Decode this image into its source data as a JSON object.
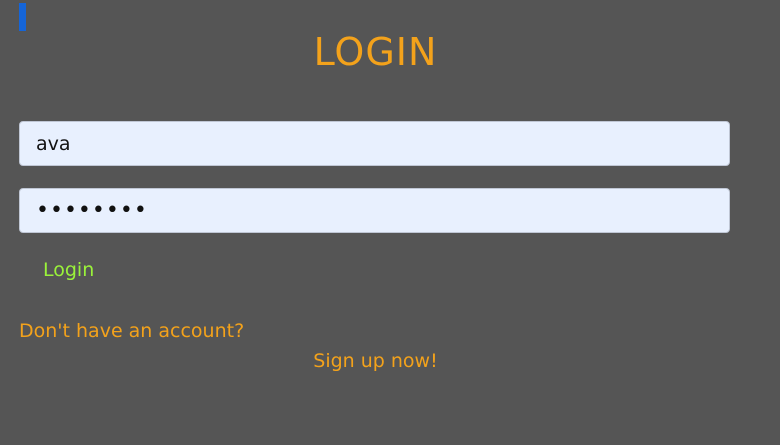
{
  "page": {
    "title": "LOGIN"
  },
  "form": {
    "username_value": "ava",
    "password_value": "ava12345",
    "login_label": "Login"
  },
  "footer": {
    "no_account_text": "Don't have an account?",
    "signup_label": "Sign up now!"
  },
  "colors": {
    "background": "#555555",
    "accent_orange": "#f3a21b",
    "login_green": "#9af23a",
    "focus_bar_blue": "#1565d8",
    "input_background": "#e8f0fe"
  }
}
